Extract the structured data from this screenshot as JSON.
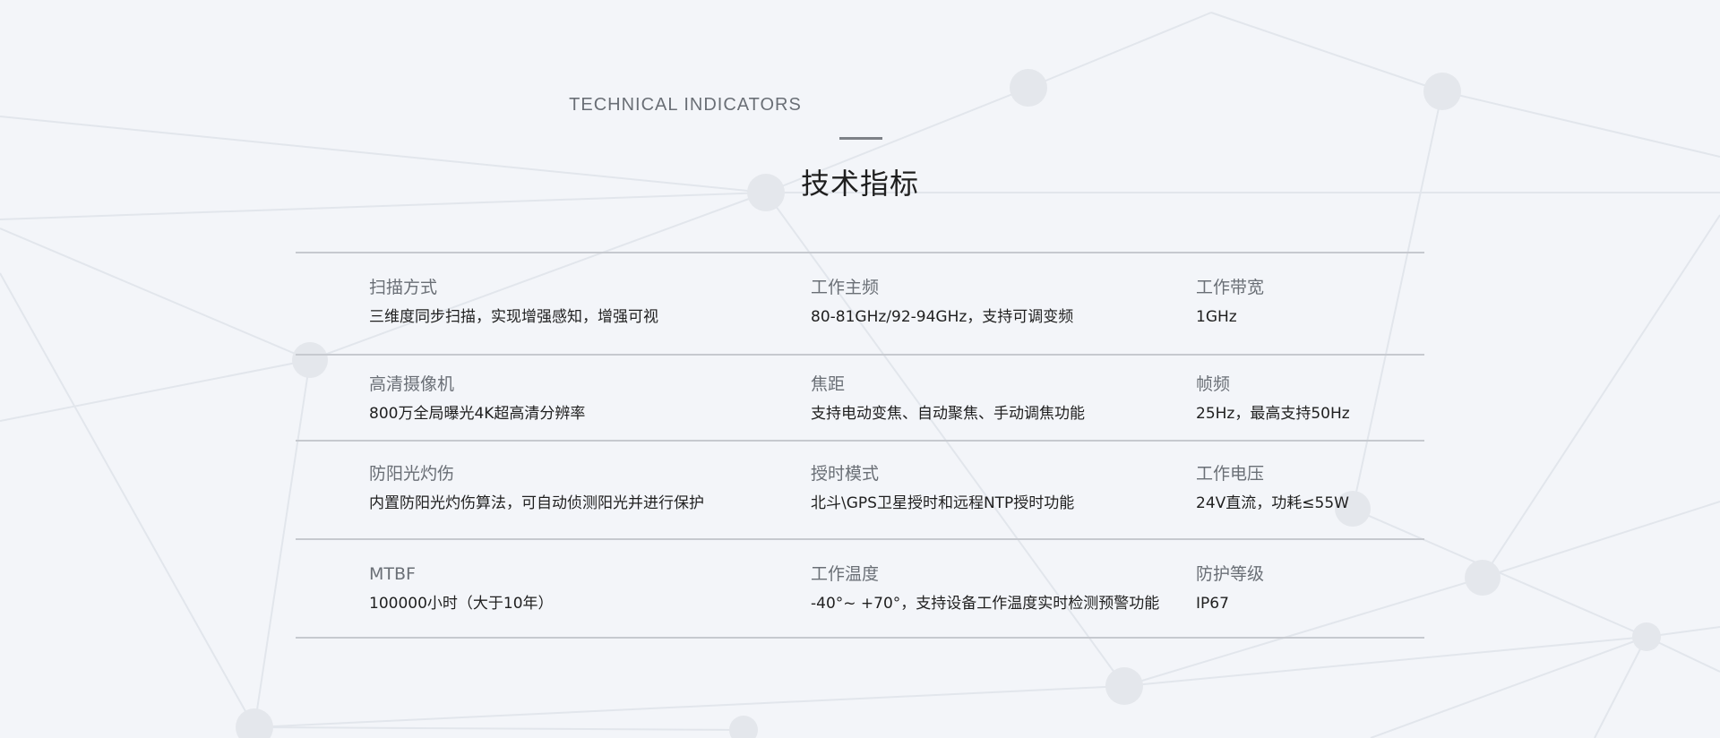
{
  "header": {
    "subtitle_en": "TECHNICAL INDICATORS",
    "title_cn": "技术指标"
  },
  "specs": [
    [
      {
        "label": "扫描方式",
        "value": "三维度同步扫描，实现增强感知，增强可视"
      },
      {
        "label": "工作主频",
        "value": "80-81GHz/92-94GHz，支持可调变频"
      },
      {
        "label": "工作带宽",
        "value": "1GHz"
      }
    ],
    [
      {
        "label": "高清摄像机",
        "value": "800万全局曝光4K超高清分辨率"
      },
      {
        "label": "焦距",
        "value": "支持电动变焦、自动聚焦、手动调焦功能"
      },
      {
        "label": "帧频",
        "value": "25Hz，最高支持50Hz"
      }
    ],
    [
      {
        "label": "防阳光灼伤",
        "value": "内置防阳光灼伤算法，可自动侦测阳光并进行保护"
      },
      {
        "label": "授时模式",
        "value": "北斗\\GPS卫星授时和远程NTP授时功能"
      },
      {
        "label": "工作电压",
        "value": "24V直流，功耗≤55W"
      }
    ],
    [
      {
        "label": "MTBF",
        "value": "100000小时（大于10年）"
      },
      {
        "label": "工作温度",
        "value": "-40°~ +70°，支持设备工作温度实时检测预警功能"
      },
      {
        "label": "防护等级",
        "value": "IP67"
      }
    ]
  ],
  "colors": {
    "background": "#f3f5f9",
    "divider": "#c6c9cf",
    "label": "#6a6f76",
    "value": "#1f1f1f",
    "network": "#dfe3ea"
  }
}
